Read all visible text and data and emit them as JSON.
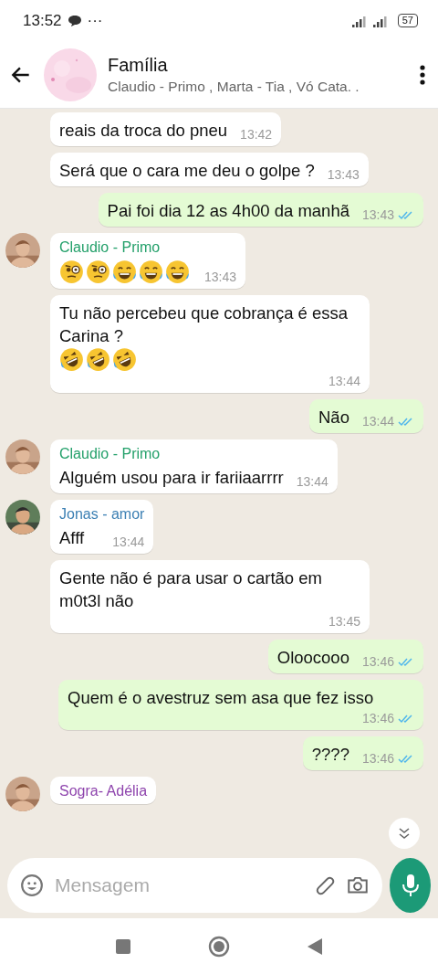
{
  "status_bar": {
    "time": "13:52",
    "more": "···",
    "battery": "57"
  },
  "header": {
    "title": "Família",
    "subtitle": "Claudio - Primo , Marta - Tia , Vó Cata. ."
  },
  "messages": [
    {
      "kind": "incoming",
      "text": "reais da troca do pneu",
      "time": "13:42"
    },
    {
      "kind": "incoming",
      "text": "Será que o cara me deu o golpe ?",
      "time": "13:43"
    },
    {
      "kind": "outgoing",
      "text": "Pai foi dia 12 as 4h00 da manhã",
      "time": "13:43",
      "read": true
    },
    {
      "kind": "incoming",
      "sender": "Claudio - Primo",
      "color": "#23a06a",
      "emojis": [
        {
          "kind": "monocle"
        },
        {
          "kind": "monocle"
        },
        {
          "kind": "tears-of-joy"
        },
        {
          "kind": "tears-of-joy"
        },
        {
          "kind": "tears-of-joy"
        }
      ],
      "time": "13:43"
    },
    {
      "kind": "incoming",
      "text": "Tu não percebeu que cobrança é essa Carina ?",
      "emojis": [
        {
          "kind": "rolling-laugh"
        },
        {
          "kind": "rolling-laugh"
        },
        {
          "kind": "rolling-laugh"
        }
      ],
      "time": "13:44"
    },
    {
      "kind": "outgoing",
      "text": "Não",
      "time": "13:44",
      "read": true
    },
    {
      "kind": "incoming",
      "sender": "Claudio - Primo",
      "color": "#23a06a",
      "text": "Alguém usou para ir fariiaarrrr",
      "time": "13:44"
    },
    {
      "kind": "incoming",
      "sender": "Jonas - amor",
      "color": "#3b7fb3",
      "text": "Afff",
      "time": "13:44"
    },
    {
      "kind": "incoming",
      "text": "Gente não é para usar o cartão em m0t3l não",
      "time": "13:45"
    },
    {
      "kind": "outgoing",
      "text": "Oloocooo",
      "time": "13:46",
      "read": true
    },
    {
      "kind": "outgoing",
      "text": "Quem é o avestruz sem asa que fez isso",
      "time": "13:46",
      "read": true
    },
    {
      "kind": "outgoing",
      "text": "????",
      "time": "13:46",
      "read": true
    },
    {
      "kind": "incoming",
      "sender": "Sogra- Adélia",
      "color": "#8e44ad"
    }
  ],
  "composer": {
    "placeholder": "Mensagem"
  }
}
